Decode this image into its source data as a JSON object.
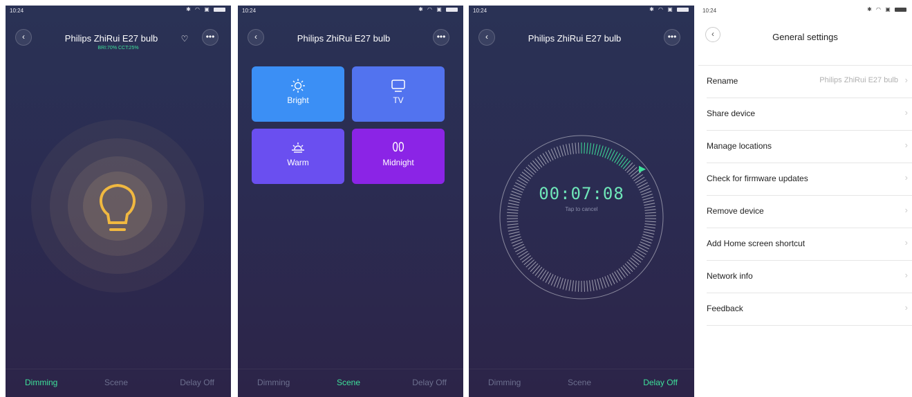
{
  "status": {
    "time": "10:24"
  },
  "panel1": {
    "title": "Philips ZhiRui E27 bulb",
    "subtitle": "BRI:70% CCT:25%",
    "tabs": [
      "Dimming",
      "Scene",
      "Delay Off"
    ],
    "active_tab": 0,
    "glow_color": "#f0b840"
  },
  "panel2": {
    "title": "Philips ZhiRui E27 bulb",
    "scenes": [
      {
        "label": "Bright",
        "icon": "sun-icon",
        "color": "#3b8ff5"
      },
      {
        "label": "TV",
        "icon": "tv-icon",
        "color": "#5273ef"
      },
      {
        "label": "Warm",
        "icon": "sunrise-icon",
        "color": "#6a4ff0"
      },
      {
        "label": "Midnight",
        "icon": "footprints-icon",
        "color": "#8b24e6"
      }
    ],
    "tabs": [
      "Dimming",
      "Scene",
      "Delay Off"
    ],
    "active_tab": 1
  },
  "panel3": {
    "title": "Philips ZhiRui E27 bulb",
    "timer": "00:07:08",
    "hint": "Tap to cancel",
    "progress": 0.12,
    "tabs": [
      "Dimming",
      "Scene",
      "Delay Off"
    ],
    "active_tab": 2,
    "accent": "#3ee09a"
  },
  "settings": {
    "title": "General settings",
    "items": [
      {
        "label": "Rename",
        "value": "Philips ZhiRui E27 bulb"
      },
      {
        "label": "Share device",
        "value": ""
      },
      {
        "label": "Manage locations",
        "value": ""
      },
      {
        "label": "Check for firmware updates",
        "value": ""
      },
      {
        "label": "Remove device",
        "value": ""
      },
      {
        "label": "Add Home screen shortcut",
        "value": ""
      },
      {
        "label": "Network info",
        "value": ""
      },
      {
        "label": "Feedback",
        "value": ""
      }
    ]
  }
}
